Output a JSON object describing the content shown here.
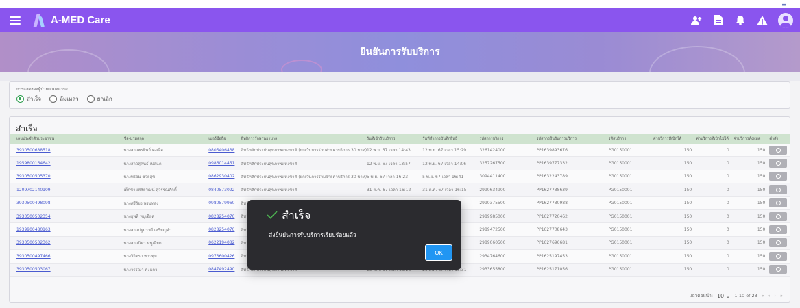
{
  "app": {
    "title": "A-MED Care"
  },
  "banner": {
    "title": "ยืนยันการรับบริการ"
  },
  "filter": {
    "label": "การแสดงผลผู้ป่วยตามสถานะ",
    "options": [
      {
        "label": "สำเร็จ",
        "checked": true
      },
      {
        "label": "ล้มเหลว",
        "checked": false
      },
      {
        "label": "ยกเลิก",
        "checked": false
      }
    ]
  },
  "table": {
    "title": "สำเร็จ",
    "headers": [
      "เลขประจำตัวประชาชน",
      "ชื่อ-นามสกุล",
      "เบอร์มือถือ",
      "สิทธิการรักษาพยาบาล",
      "วันที่เข้ารับบริการ",
      "วันที่ทำการบันทึกสิทธิ์",
      "รหัสการบริการ",
      "รหัสการยืนยันการบริการ",
      "รหัสบริการ",
      "ค่าบริการที่เบิกได้",
      "ค่าบริการที่เบิกไม่ได้",
      "ค่าบริการทั้งหมด",
      "คำสั่ง"
    ],
    "rows": [
      [
        "3930500688518",
        "นางสาวพรทิพย์ คงเจือ",
        "0805406438",
        "สิทธิหลักประกันสุขภาพแห่งชาติ (ยกเว้นการร่วมจ่ายค่าบริการ 30 บาท)",
        "12 พ.ย. 67 เวลา 14:43",
        "12 พ.ย. 67 เวลา 15:29",
        "3261424000",
        "PP1639893676",
        "PG0150001",
        "150",
        "0",
        "150"
      ],
      [
        "1959800164642",
        "นางสาวสุคนธ์ เปลแก",
        "0986014451",
        "สิทธิหลักประกันสุขภาพแห่งชาติ",
        "12 พ.ย. 67 เวลา 13:57",
        "12 พ.ย. 67 เวลา 14:06",
        "3257267500",
        "PP1639777332",
        "PG0150001",
        "150",
        "0",
        "150"
      ],
      [
        "3930500505370",
        "นางพร้อม ช่วยสุข",
        "0862930402",
        "สิทธิหลักประกันสุขภาพแห่งชาติ (ยกเว้นการร่วมจ่ายค่าบริการ 30 บาท)",
        "5 พ.ย. 67 เวลา 16:23",
        "5 พ.ย. 67 เวลา 16:41",
        "3094411400",
        "PP1632243789",
        "PG0150001",
        "150",
        "0",
        "150"
      ],
      [
        "1209702140109",
        "เด็กชายพิชัยวัฒน์ สุวรรณศักดิ์",
        "0840573022",
        "สิทธิหลักประกันสุขภาพแห่งชาติ",
        "31 ต.ค. 67 เวลา 16:12",
        "31 ต.ค. 67 เวลา 16:15",
        "2990634900",
        "PP1627738639",
        "PG0150001",
        "150",
        "0",
        "150"
      ],
      [
        "3930500498098",
        "นางศรีวิยง พรมทอง",
        "0980579960",
        "สิทธิหลักประกันสุขภาพ",
        "",
        "4",
        "2990375500",
        "PP1627730988",
        "PG0150001",
        "150",
        "0",
        "150"
      ],
      [
        "3930500502354",
        "นางยุพดี หนูเอียด",
        "0828254070",
        "สิทธิหลักประกันสุขภาพ",
        "",
        "",
        "2989985000",
        "PP1627720462",
        "PG0150001",
        "150",
        "0",
        "150"
      ],
      [
        "1939900480163",
        "นางสาวปฐมาวดี เหรียญคำ",
        "0828254070",
        "สิทธิหลักประกันสุขภาพ",
        "",
        "9",
        "2989472500",
        "PP1627708643",
        "PG0150001",
        "150",
        "0",
        "150"
      ],
      [
        "3930500502362",
        "นางสาวนิดา หนูเอียด",
        "0622194082",
        "สิทธิหลักประกันสุขภาพ",
        "",
        "8",
        "2989060500",
        "PP1627696681",
        "PG0150001",
        "150",
        "0",
        "150"
      ],
      [
        "3930500497466",
        "นางวิจิตรา ชาวพุ่ม",
        "0973600426",
        "สิทธิหลักประกันสุขภาพ",
        "",
        "59",
        "2934764600",
        "PP1625197453",
        "PG0150001",
        "150",
        "0",
        "150"
      ],
      [
        "3930500503067",
        "นางวรรณา คงแก้ว",
        "0847492490",
        "สิทธิหลักประกันสุขภาพแห่งชาติ",
        "29 ต.ค. 67 เวลา 15:26",
        "29 ต.ค. 67 เวลา 15:31",
        "2933655800",
        "PP1625171056",
        "PG0150001",
        "150",
        "0",
        "150"
      ]
    ],
    "footer": {
      "rows_per_page_label": "แถวต่อหน้า:",
      "rows_per_page": "10",
      "range": "1-10 of 23"
    }
  },
  "dialog": {
    "title": "สำเร็จ",
    "message": "ส่งยืนยันการรับบริการเรียบร้อยแล้ว",
    "ok_label": "OK"
  },
  "colors": {
    "appbar": "#8a55ee",
    "table_header": "#cfe3cf",
    "link": "#4a5bd0",
    "ok_button": "#2196f3",
    "success_check": "#2e9e4f"
  }
}
